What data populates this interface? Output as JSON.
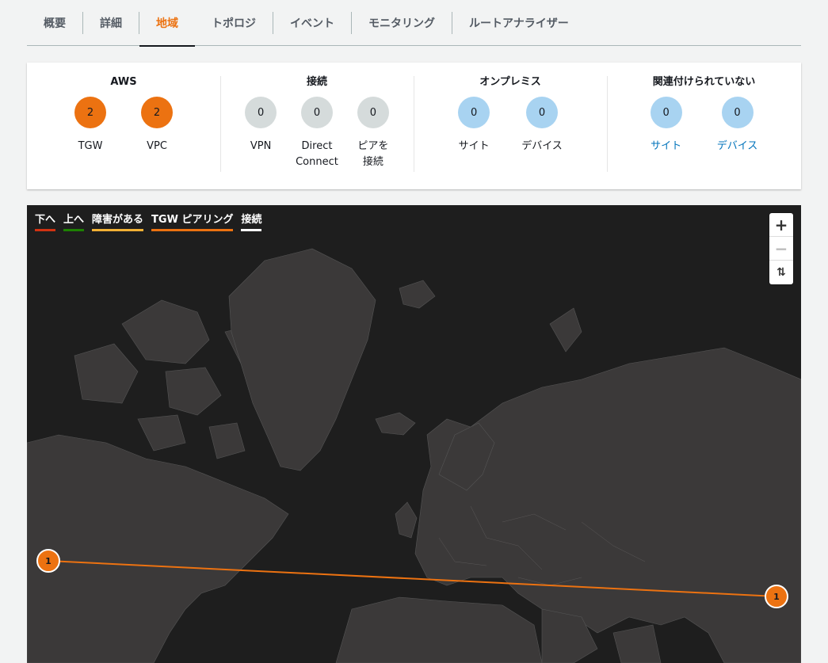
{
  "tabs": [
    {
      "label": "概要",
      "active": false
    },
    {
      "label": "詳細",
      "active": false
    },
    {
      "label": "地域",
      "active": true
    },
    {
      "label": "トポロジ",
      "active": false
    },
    {
      "label": "イベント",
      "active": false
    },
    {
      "label": "モニタリング",
      "active": false
    },
    {
      "label": "ルートアナライザー",
      "active": false
    }
  ],
  "summary": {
    "aws": {
      "title": "AWS",
      "tgw": {
        "count": "2",
        "label": "TGW"
      },
      "vpc": {
        "count": "2",
        "label": "VPC"
      }
    },
    "connections": {
      "title": "接続",
      "vpn": {
        "count": "0",
        "label": "VPN"
      },
      "dc": {
        "count": "0",
        "label_line1": "Direct",
        "label_line2": "Connect"
      },
      "peer": {
        "count": "0",
        "label_line1": "ピアを",
        "label_line2": "接続"
      }
    },
    "onprem": {
      "title": "オンプレミス",
      "site": {
        "count": "0",
        "label": "サイト"
      },
      "device": {
        "count": "0",
        "label": "デバイス"
      }
    },
    "unassoc": {
      "title": "関連付けられていない",
      "site": {
        "count": "0",
        "label": "サイト"
      },
      "device": {
        "count": "0",
        "label": "デバイス"
      }
    }
  },
  "map": {
    "legend": [
      {
        "label": "下へ",
        "color": "#d13212"
      },
      {
        "label": "上へ",
        "color": "#1d8102"
      },
      {
        "label": "障害がある",
        "color": "#f2b135"
      },
      {
        "label": "TGW ピアリング",
        "color": "#ec7211"
      },
      {
        "label": "接続",
        "color": "#ffffff"
      }
    ],
    "zoom_in": "+",
    "zoom_out": "−",
    "reset": "⇅",
    "markers": [
      {
        "count": "1"
      },
      {
        "count": "1"
      }
    ],
    "peering_line_color": "#ec7211"
  }
}
